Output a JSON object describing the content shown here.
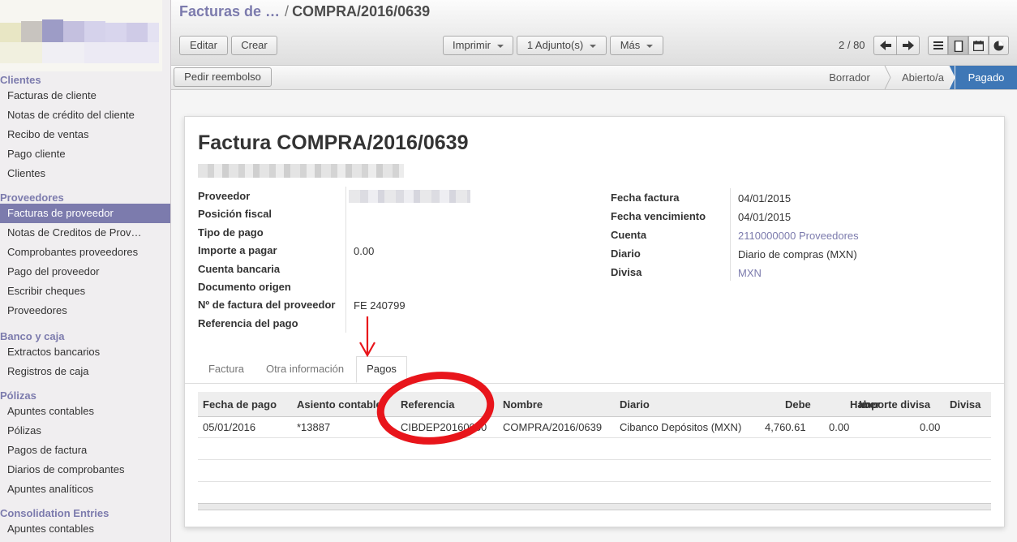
{
  "sidebar": {
    "sections": [
      {
        "title": "Clientes",
        "items": [
          "Facturas de cliente",
          "Notas de crédito del cliente",
          "Recibo de ventas",
          "Pago cliente",
          "Clientes"
        ]
      },
      {
        "title": "Proveedores",
        "items": [
          "Facturas de proveedor",
          "Notas de Creditos de Prov…",
          "Comprobantes proveedores",
          "Pago del proveedor",
          "Escribir cheques",
          "Proveedores"
        ]
      },
      {
        "title": "Banco y caja",
        "items": [
          "Extractos bancarios",
          "Registros de caja"
        ]
      },
      {
        "title": "Pólizas",
        "items": [
          "Apuntes contables",
          "Pólizas",
          "Pagos de factura",
          "Diarios de comprobantes",
          "Apuntes analíticos"
        ]
      },
      {
        "title": "Consolidation Entries",
        "items": [
          "Apuntes contables"
        ]
      }
    ],
    "active_item": "Facturas de proveedor"
  },
  "breadcrumb": {
    "parent": "Facturas de …",
    "separator": "/",
    "current": "COMPRA/2016/0639"
  },
  "toolbar": {
    "edit": "Editar",
    "create": "Crear",
    "print": "Imprimir",
    "attachments": "1 Adjunto(s)",
    "more": "Más",
    "pager": "2 / 80"
  },
  "action_button": "Pedir reembolso",
  "status_stages": [
    "Borrador",
    "Abierto/a",
    "Pagado"
  ],
  "active_stage": "Pagado",
  "form": {
    "title": "Factura COMPRA/2016/0639",
    "left_fields": [
      {
        "label": "Proveedor",
        "value": ""
      },
      {
        "label": "Posición fiscal",
        "value": ""
      },
      {
        "label": "Tipo de pago",
        "value": ""
      },
      {
        "label": "Importe a pagar",
        "value": "0.00"
      },
      {
        "label": "Cuenta bancaria",
        "value": ""
      },
      {
        "label": "Documento origen",
        "value": ""
      },
      {
        "label": "Nº de factura del proveedor",
        "value": "FE 240799"
      },
      {
        "label": "Referencia del pago",
        "value": ""
      }
    ],
    "right_fields": [
      {
        "label": "Fecha factura",
        "value": "04/01/2015"
      },
      {
        "label": "Fecha vencimiento",
        "value": "04/01/2015"
      },
      {
        "label": "Cuenta",
        "value": "2110000000 Proveedores"
      },
      {
        "label": "Diario",
        "value": "Diario de compras (MXN)"
      },
      {
        "label": "Divisa",
        "value": "MXN"
      }
    ],
    "tabs": [
      "Factura",
      "Otra información",
      "Pagos"
    ],
    "active_tab": "Pagos"
  },
  "payments_table": {
    "columns": [
      "Fecha de pago",
      "Asiento contable",
      "Referencia",
      "Nombre",
      "Diario",
      "Debe",
      "Haber",
      "Importe divisa",
      "Divisa"
    ],
    "rows": [
      [
        "05/01/2016",
        "*13887",
        "CIBDEP20160080",
        "COMPRA/2016/0639",
        "Cibanco Depósitos (MXN)",
        "4,760.61",
        "0.00",
        "0.00",
        ""
      ]
    ]
  },
  "colors": {
    "accent": "#7c7bad",
    "active_stage": "#3e77b6",
    "annotation": "#e8151b"
  }
}
